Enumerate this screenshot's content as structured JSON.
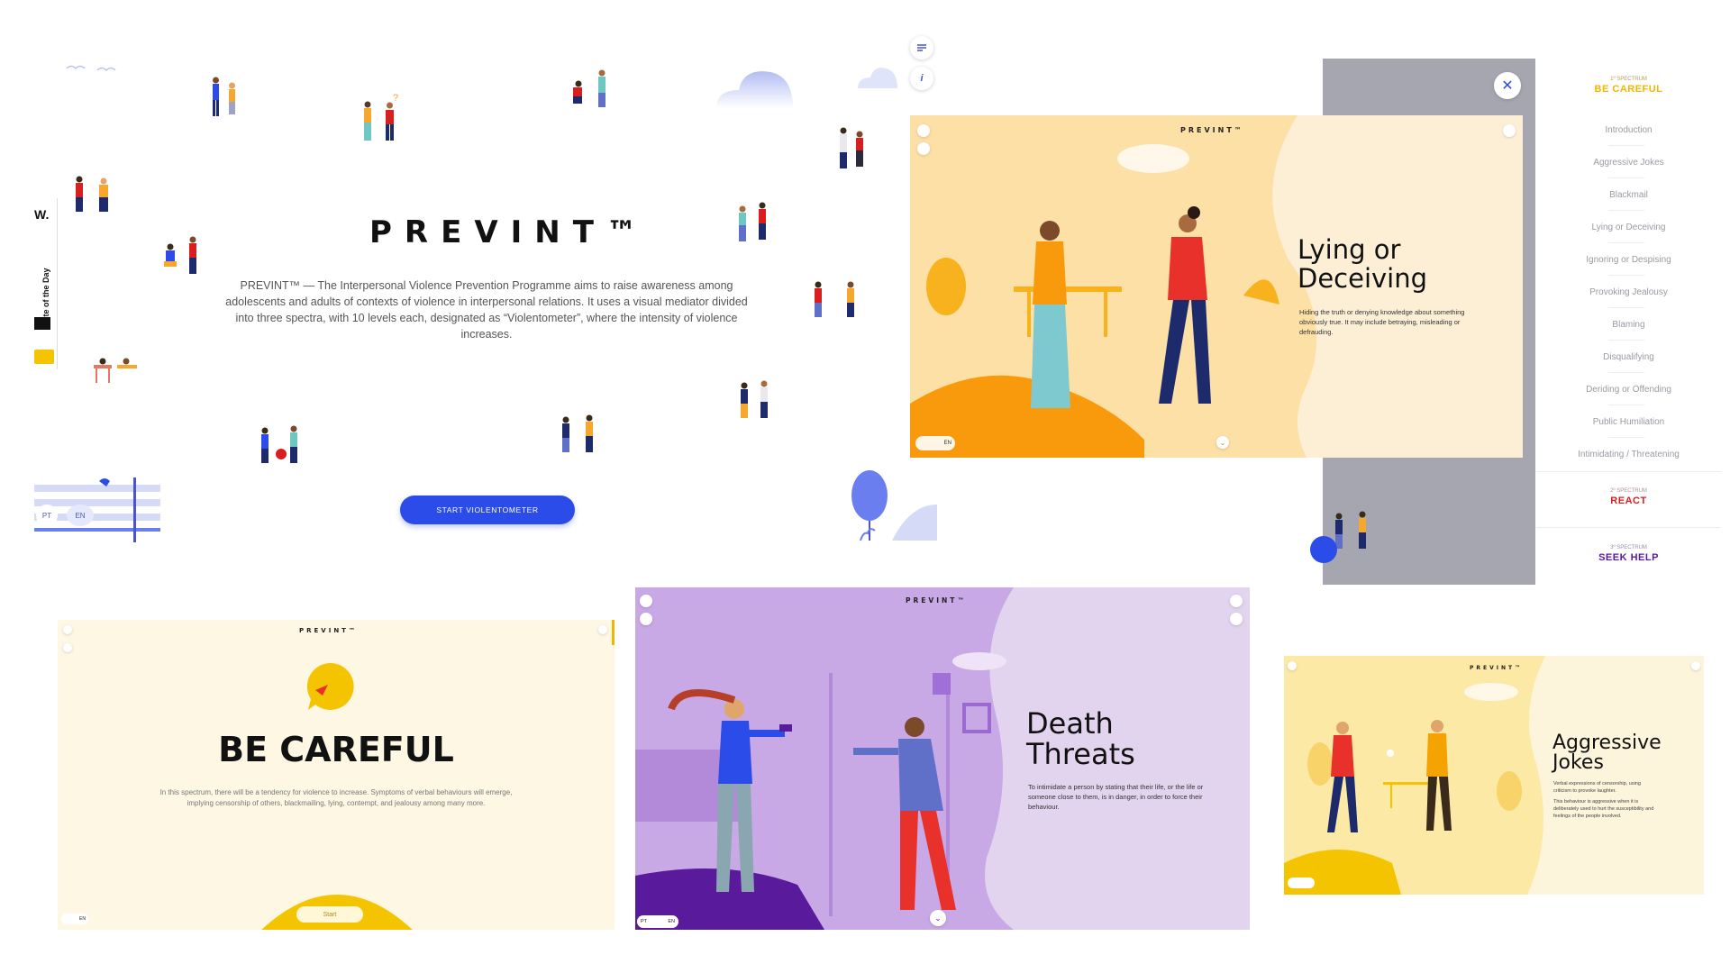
{
  "landing": {
    "logo": "PREVINT™",
    "intro": "PREVINT™ — The Interpersonal Violence Prevention Programme aims to raise awareness among adolescents and adults of contexts of violence in interpersonal relations. It uses a visual mediator divided into three spectra, with 10 levels each, designated as “Violentometer”, where the intensity of violence increases.",
    "start_button": "START VIOLENTOMETER",
    "lang_pt": "PT",
    "lang_en": "EN",
    "menu_icon": "menu-lines-icon",
    "info_icon": "info-icon",
    "info_glyph": "i",
    "award": {
      "w": "W.",
      "text": "Site of the Day"
    }
  },
  "lying_panel": {
    "logo": "PREVINT™",
    "title_line1": "Lying or",
    "title_line2": "Deceiving",
    "description": "Hiding the truth or denying knowledge about something obviously true. It may include betraying, misleading or defrauding.",
    "lang_en": "EN"
  },
  "menu": {
    "close_glyph": "✕",
    "spectrum1_label": "1º SPECTRUM",
    "spectrum1_title": "BE CAREFUL",
    "items": [
      "Introduction",
      "Aggressive Jokes",
      "Blackmail",
      "Lying or Deceiving",
      "Ignoring or Despising",
      "Provoking Jealousy",
      "Blaming",
      "Disqualifying",
      "Deriding or Offending",
      "Public Humiliation",
      "Intimidating / Threatening"
    ],
    "spectrum2_label": "2º SPECTRUM",
    "spectrum2_title": "REACT",
    "spectrum3_label": "3º SPECTRUM",
    "spectrum3_title": "SEEK HELP",
    "colors": {
      "careful": "#f5b400",
      "react": "#d81e1e",
      "help": "#5a1a9c"
    }
  },
  "careful_panel": {
    "logo": "PREVINT™",
    "title": "BE CAREFUL",
    "text": "In this spectrum, there will be a tendency for violence to increase. Symptoms of verbal behaviours will emerge, implying censorship of others, blackmailing, lying, contempt, and jealousy among many more.",
    "start": "Start",
    "lang_en": "EN"
  },
  "death_panel": {
    "logo": "PREVINT™",
    "title_line1": "Death",
    "title_line2": "Threats",
    "description": "To intimidate a person by stating that their life, or the life or someone close to them, is in danger, in order to force their behaviour.",
    "lang_pt": "PT",
    "lang_en": "EN"
  },
  "jokes_panel": {
    "logo": "PREVINT™",
    "title_line1": "Aggressive",
    "title_line2": "Jokes",
    "description1": "Verbal expressions of censorship, using criticism to provoke laughter.",
    "description2": "This behaviour is aggressive when it is deliberately used to hurt the susceptibility and feelings of the people involved."
  }
}
